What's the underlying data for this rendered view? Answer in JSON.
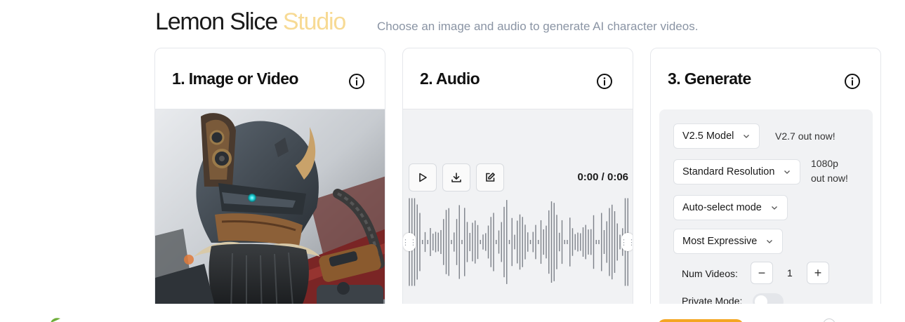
{
  "header": {
    "brand": "Lemon Slice",
    "brand_accent": "Studio",
    "tagline": "Choose an image and audio to generate AI character videos."
  },
  "cards": {
    "image": {
      "title": "1. Image or Video",
      "icon": "info-icon"
    },
    "audio": {
      "title": "2. Audio",
      "icon": "info-icon",
      "time": "0:00 / 0:06",
      "controls": [
        "play-icon",
        "download-icon",
        "edit-icon"
      ]
    },
    "generate": {
      "title": "3. Generate",
      "icon": "info-icon",
      "model": {
        "selected": "V2.5 Model",
        "note": "V2.7 out now!"
      },
      "resolution": {
        "selected": "Standard Resolution",
        "note_line1": "1080p",
        "note_line2": "out now!"
      },
      "mode": {
        "selected": "Auto-select mode"
      },
      "expressiveness": {
        "selected": "Most Expressive"
      },
      "num_videos": {
        "label": "Num Videos:",
        "value": "1",
        "minus": "−",
        "plus": "+"
      },
      "private_mode": {
        "label": "Private Mode:",
        "enabled": false
      }
    }
  },
  "colors": {
    "accent": "#f2c24e",
    "action": "#f4a622",
    "panel": "#f1f2f4",
    "border": "#e5e7eb"
  }
}
